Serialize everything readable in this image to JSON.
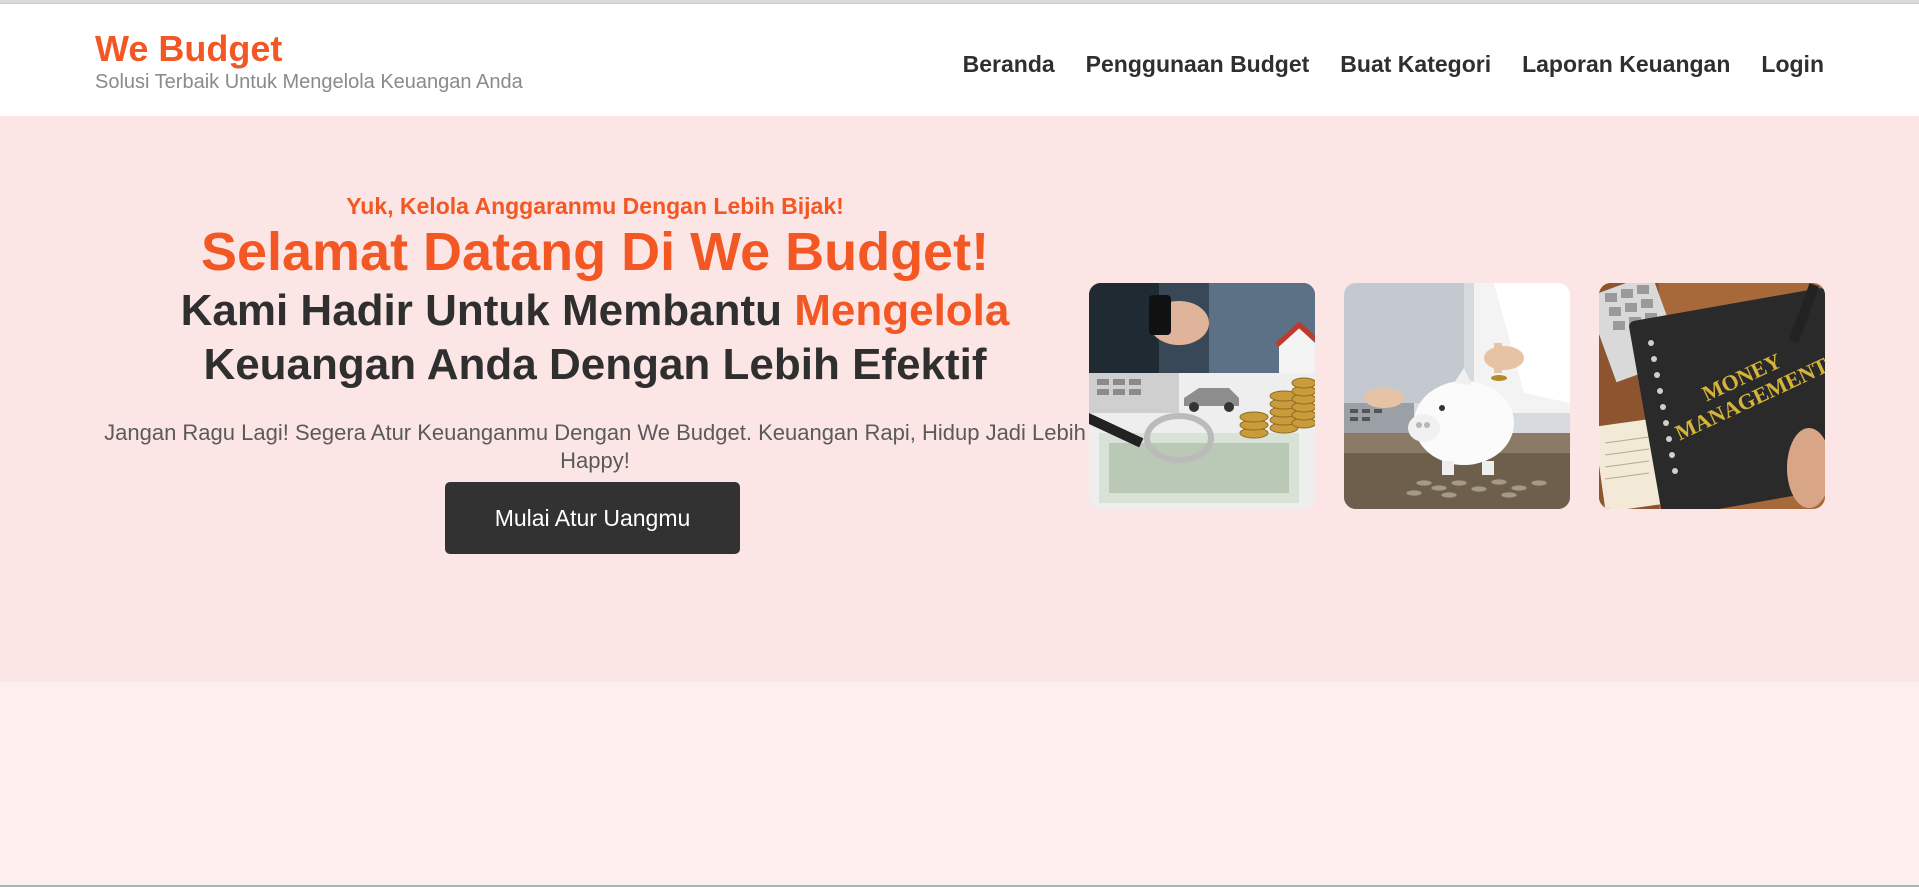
{
  "brand": {
    "title": "We Budget",
    "tagline": "Solusi Terbaik Untuk Mengelola Keuangan Anda"
  },
  "nav": {
    "items": [
      {
        "label": "Beranda"
      },
      {
        "label": "Penggunaan Budget"
      },
      {
        "label": "Buat Kategori"
      },
      {
        "label": "Laporan Keuangan"
      },
      {
        "label": "Login"
      }
    ]
  },
  "hero": {
    "kicker": "Yuk, Kelola Anggaranmu Dengan Lebih Bijak!",
    "title": "Selamat Datang Di We Budget!",
    "subtitle_part1": "Kami Hadir Untuk Membantu ",
    "subtitle_accent": "Mengelola",
    "subtitle_part2": "Keuangan Anda Dengan Lebih Efektif",
    "description": "Jangan Ragu Lagi! Segera Atur Keuanganmu Dengan We Budget. Keuangan Rapi, Hidup Jadi Lebih Happy!",
    "cta_label": "Mulai Atur Uangmu"
  },
  "gallery": {
    "photos": [
      {
        "name": "money-coins-photo"
      },
      {
        "name": "piggy-bank-photo"
      },
      {
        "name": "money-management-notebook-photo",
        "text_line1": "MONEY",
        "text_line2": "MANAGEMENT"
      }
    ]
  },
  "colors": {
    "accent": "#f35724",
    "dark": "#2f2f2f",
    "hero_bg": "#fbe6e5",
    "page_bg": "#fcefee"
  }
}
